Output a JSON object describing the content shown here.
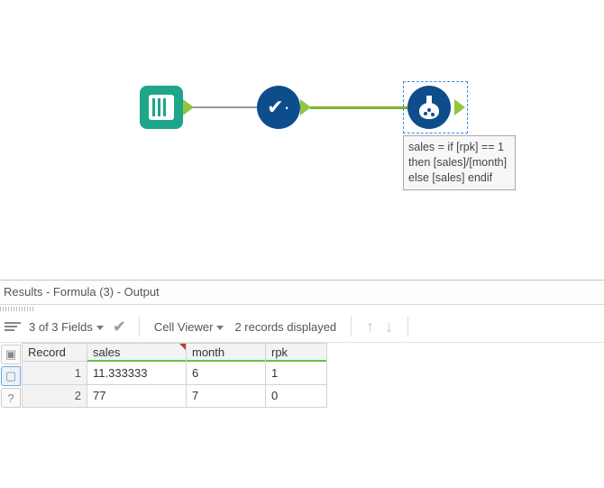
{
  "canvas": {
    "nodes": {
      "input": {
        "name": "input-tool"
      },
      "select": {
        "name": "select-tool"
      },
      "formula": {
        "name": "formula-tool"
      }
    },
    "formula_annotation": "sales = if [rpk] == 1 then [sales]/[month] else [sales] endif"
  },
  "results": {
    "panel_title": "Results - Formula (3) - Output",
    "toolbar": {
      "fields_summary": "3 of 3 Fields",
      "cell_viewer_label": "Cell Viewer",
      "records_displayed": "2 records displayed"
    },
    "grid": {
      "record_header": "Record",
      "columns": [
        "sales",
        "month",
        "rpk"
      ],
      "rows": [
        {
          "n": "1",
          "sales": "11.333333",
          "month": "6",
          "rpk": "1"
        },
        {
          "n": "2",
          "sales": "77",
          "month": "7",
          "rpk": "0"
        }
      ]
    }
  },
  "chart_data": {
    "type": "table",
    "title": "Results - Formula (3) - Output",
    "columns": [
      "Record",
      "sales",
      "month",
      "rpk"
    ],
    "rows": [
      [
        1,
        11.333333,
        6,
        1
      ],
      [
        2,
        77,
        7,
        0
      ]
    ]
  }
}
